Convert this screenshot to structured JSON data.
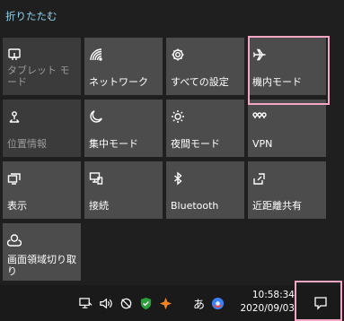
{
  "panel": {
    "collapse_label": "折りたたむ"
  },
  "tiles": [
    {
      "label": "タブレット モード",
      "icon": "tablet-mode-icon",
      "enabled": false
    },
    {
      "label": "ネットワーク",
      "icon": "network-icon",
      "enabled": true
    },
    {
      "label": "すべての設定",
      "icon": "gear-icon",
      "enabled": true
    },
    {
      "label": "機内モード",
      "icon": "airplane-icon",
      "enabled": true
    },
    {
      "label": "位置情報",
      "icon": "location-icon",
      "enabled": false
    },
    {
      "label": "集中モード",
      "icon": "moon-icon",
      "enabled": true
    },
    {
      "label": "夜間モード",
      "icon": "brightness-icon",
      "enabled": true
    },
    {
      "label": "VPN",
      "icon": "vpn-icon",
      "enabled": true
    },
    {
      "label": "表示",
      "icon": "project-display-icon",
      "enabled": true
    },
    {
      "label": "接続",
      "icon": "connect-icon",
      "enabled": true
    },
    {
      "label": "Bluetooth",
      "icon": "bluetooth-icon",
      "enabled": true
    },
    {
      "label": "近距離共有",
      "icon": "nearby-share-icon",
      "enabled": true
    },
    {
      "label": "画面領域切り取り",
      "icon": "snip-icon",
      "enabled": true
    }
  ],
  "taskbar": {
    "tray_icons": [
      "network-tray-icon",
      "volume-icon",
      "mute-icon",
      "defender-shield-icon",
      "avast-icon",
      "google-chrome-icon"
    ],
    "ime_mode": "あ",
    "time": "10:58:34",
    "date": "2020/09/03",
    "action_center": "action-center-icon"
  },
  "colors": {
    "background": "#1f1f1f",
    "tile": "#4c4c4c",
    "tile_disabled": "#3b3b3b",
    "accent_link": "#8fd3ee",
    "highlight": "#f4a7c5"
  }
}
